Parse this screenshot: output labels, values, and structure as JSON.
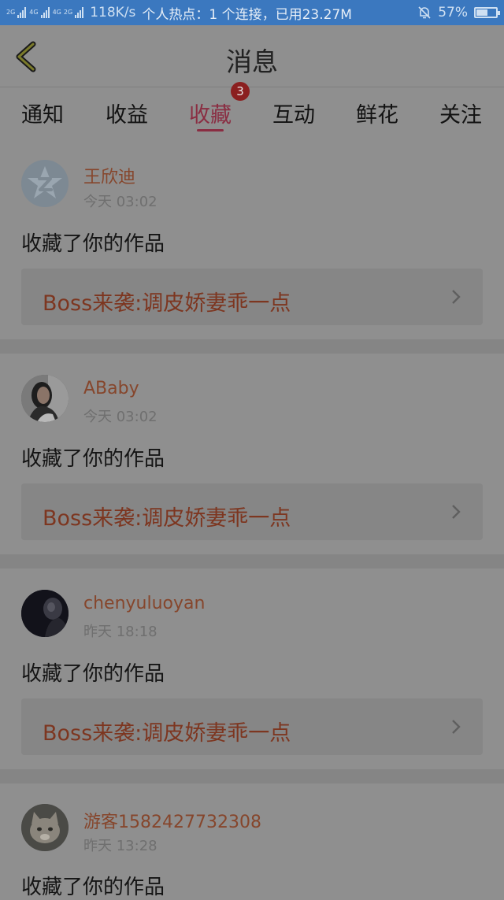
{
  "status_bar": {
    "net1": "2G",
    "net2": "4G",
    "net3": "4G",
    "net4": "2G",
    "speed": "118K/s",
    "hotspot": "个人热点：1 个连接，已用23.27M",
    "battery": "57%",
    "battery_level": 0.57
  },
  "header": {
    "title": "消息"
  },
  "tabs": {
    "items": [
      {
        "label": "通知"
      },
      {
        "label": "收益"
      },
      {
        "label": "收藏"
      },
      {
        "label": "互动"
      },
      {
        "label": "鲜花"
      },
      {
        "label": "关注"
      }
    ],
    "active_index": 2,
    "badge": "3"
  },
  "feed": [
    {
      "user": "王欣迪",
      "time": "今天 03:02",
      "action": "收藏了你的作品",
      "work": "Boss来袭:调皮娇妻乖一点",
      "avatar": "default-logo-avatar"
    },
    {
      "user": "ABaby",
      "time": "今天 03:02",
      "action": "收藏了你的作品",
      "work": "Boss来袭:调皮娇妻乖一点",
      "avatar": "woman-photo-avatar"
    },
    {
      "user": "chenyuluoyan",
      "time": "昨天 18:18",
      "action": "收藏了你的作品",
      "work": "Boss来袭:调皮娇妻乖一点",
      "avatar": "dark-photo-avatar"
    },
    {
      "user": "游客1582427732308",
      "time": "昨天 13:28",
      "action": "收藏了你的作品",
      "work": "",
      "avatar": "cat-photo-avatar"
    }
  ],
  "colors": {
    "accent": "#8a2d42",
    "username": "#86462c",
    "work_title": "#7d3620",
    "status_bar": "#3b78bf"
  }
}
